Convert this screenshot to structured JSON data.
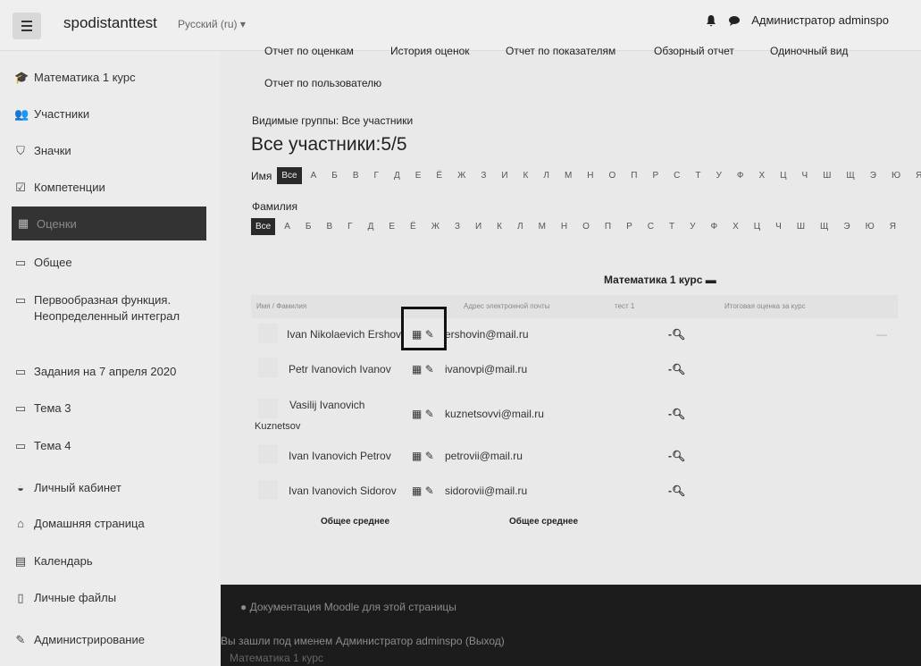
{
  "header": {
    "site_name": "spodistanttest",
    "language": "Русский (ru)",
    "user_name": "Администратор adminspo"
  },
  "sidebar": {
    "items": [
      {
        "label": "Математика 1 курс",
        "icon": "graduation-cap-icon"
      },
      {
        "label": "Участники",
        "icon": "users-icon"
      },
      {
        "label": "Значки",
        "icon": "shield-icon"
      },
      {
        "label": "Компетенции",
        "icon": "checkbox-icon"
      },
      {
        "label": "Оценки",
        "icon": "table-icon",
        "active": true
      },
      {
        "label": "Общее",
        "icon": "folder-icon"
      },
      {
        "label": "Первообразная функция. Неопределенный интеграл",
        "icon": "folder-icon"
      },
      {
        "label": "Задания на 7 апреля 2020",
        "icon": "folder-icon"
      },
      {
        "label": "Тема 3",
        "icon": "folder-icon"
      },
      {
        "label": "Тема 4",
        "icon": "folder-icon"
      },
      {
        "label": "Личный кабинет",
        "icon": "dashboard-icon"
      },
      {
        "label": "Домашняя страница",
        "icon": "home-icon"
      },
      {
        "label": "Календарь",
        "icon": "calendar-icon"
      },
      {
        "label": "Личные файлы",
        "icon": "file-icon"
      },
      {
        "label": "Администрирование",
        "icon": "wrench-icon"
      }
    ]
  },
  "tabs": [
    "Отчет по оценкам",
    "История оценок",
    "Отчет по показателям",
    "Обзорный отчет",
    "Одиночный вид",
    "Отчет по пользователю"
  ],
  "groups_label": "Видимые группы: Все участники",
  "page_title": "Все участники:5/5",
  "first_name_filter": {
    "label": "Имя",
    "all": "Все",
    "letters": [
      "А",
      "Б",
      "В",
      "Г",
      "Д",
      "Е",
      "Ё",
      "Ж",
      "З",
      "И",
      "К",
      "Л",
      "М",
      "Н",
      "О",
      "П",
      "Р",
      "С",
      "Т",
      "У",
      "Ф",
      "Х",
      "Ц",
      "Ч",
      "Ш",
      "Щ",
      "Э",
      "Ю",
      "Я"
    ]
  },
  "surname_filter": {
    "label": "Фамилия",
    "all": "Все",
    "letters": [
      "А",
      "Б",
      "В",
      "Г",
      "Д",
      "Е",
      "Ё",
      "Ж",
      "З",
      "И",
      "К",
      "Л",
      "М",
      "Н",
      "О",
      "П",
      "Р",
      "С",
      "Т",
      "У",
      "Ф",
      "Х",
      "Ц",
      "Ч",
      "Ш",
      "Щ",
      "Э",
      "Ю",
      "Я"
    ]
  },
  "grader": {
    "course_header": "Математика 1 курс",
    "columns": {
      "name": "Имя / Фамилия",
      "email": "Адрес электронной почты",
      "item": "тест 1",
      "total": "Итоговая оценка за курс"
    },
    "rows": [
      {
        "name": "Ivan Nikolaevich Ershov",
        "email": "ershovin@mail.ru",
        "grade": "-",
        "total": "—"
      },
      {
        "name": "Petr Ivanovich Ivanov",
        "email": "ivanovpi@mail.ru",
        "grade": "-",
        "total": ""
      },
      {
        "name": "Vasilij Ivanovich",
        "name2": "Kuznetsov",
        "email": "kuznetsovvi@mail.ru",
        "grade": "-",
        "total": ""
      },
      {
        "name": "Ivan Ivanovich Petrov",
        "email": "petrovii@mail.ru",
        "grade": "-",
        "total": ""
      },
      {
        "name": "Ivan Ivanovich Sidorov",
        "email": "sidorovii@mail.ru",
        "grade": "-",
        "total": ""
      }
    ],
    "average_label_1": "Общее среднее",
    "average_label_2": "Общее среднее"
  },
  "footer": {
    "doc_link": "Документация Moodle для этой страницы",
    "logged_in": "Вы зашли под именем Администратор adminspo (Выход)",
    "home": "Математика 1 курс"
  }
}
